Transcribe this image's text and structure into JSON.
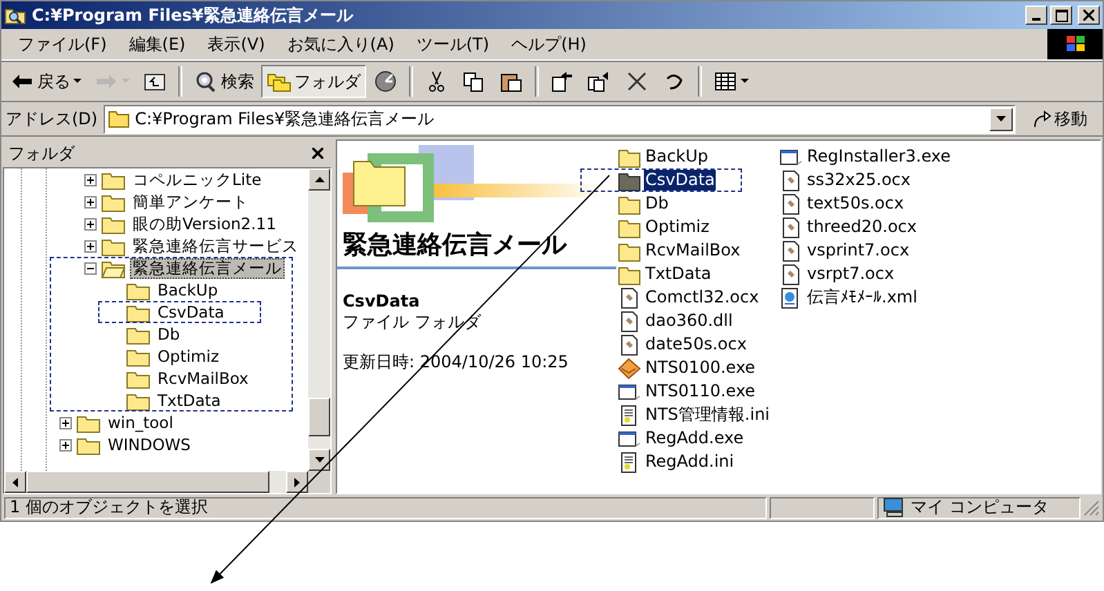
{
  "window": {
    "title": "C:¥Program Files¥緊急連絡伝言メール"
  },
  "menu": [
    "ファイル(F)",
    "編集(E)",
    "表示(V)",
    "お気に入り(A)",
    "ツール(T)",
    "ヘルプ(H)"
  ],
  "toolbar": {
    "groups": [
      [
        {
          "kind": "back",
          "label": "戻る",
          "dropdown": true,
          "disabled": false,
          "selected": false
        },
        {
          "kind": "forward",
          "dropdown": true,
          "disabled": true,
          "selected": false
        },
        {
          "kind": "up",
          "dropdown": false,
          "disabled": false,
          "selected": false
        }
      ],
      [
        {
          "kind": "search",
          "label": "検索",
          "dropdown": false,
          "disabled": false,
          "selected": false
        },
        {
          "kind": "folders",
          "label": "フォルダ",
          "dropdown": false,
          "disabled": false,
          "selected": true
        },
        {
          "kind": "history",
          "dropdown": false,
          "disabled": false,
          "selected": false
        }
      ],
      [
        {
          "kind": "cut",
          "dropdown": false,
          "disabled": false,
          "selected": false
        },
        {
          "kind": "copy",
          "dropdown": false,
          "disabled": false,
          "selected": false
        },
        {
          "kind": "paste",
          "dropdown": false,
          "disabled": false,
          "selected": false
        }
      ],
      [
        {
          "kind": "moveto",
          "dropdown": false,
          "disabled": false,
          "selected": false
        },
        {
          "kind": "copyto",
          "dropdown": false,
          "disabled": false,
          "selected": false
        },
        {
          "kind": "delete",
          "dropdown": false,
          "disabled": false,
          "selected": false
        },
        {
          "kind": "undo",
          "dropdown": false,
          "disabled": false,
          "selected": false
        }
      ],
      [
        {
          "kind": "views",
          "dropdown": true,
          "disabled": false,
          "selected": false
        }
      ]
    ]
  },
  "address": {
    "label": "アドレス(D)",
    "value": "C:¥Program Files¥緊急連絡伝言メール",
    "go": "移動"
  },
  "folder_pane": {
    "title": "フォルダ",
    "tree": [
      {
        "children": [
          {
            "label": "コペルニックLite",
            "expanded": false,
            "selected": false,
            "marked": false
          },
          {
            "label": "簡単アンケート",
            "expanded": false,
            "selected": false,
            "marked": false
          },
          {
            "label": "眼の助Version2.11",
            "expanded": false,
            "selected": false,
            "marked": false
          },
          {
            "label": "緊急連絡伝言サービス",
            "expanded": false,
            "selected": false,
            "marked": false
          },
          {
            "label": "緊急連絡伝言メール",
            "expanded": true,
            "selected": true,
            "marked": true,
            "children": [
              {
                "label": "BackUp",
                "selected": false,
                "marked": false
              },
              {
                "label": "CsvData",
                "selected": false,
                "marked": true
              },
              {
                "label": "Db",
                "selected": false,
                "marked": false
              },
              {
                "label": "Optimiz",
                "selected": false,
                "marked": false
              },
              {
                "label": "RcvMailBox",
                "selected": false,
                "marked": false
              },
              {
                "label": "TxtData",
                "selected": false,
                "marked": false
              }
            ]
          }
        ]
      },
      {
        "label": "win_tool",
        "expanded": false,
        "selected": false,
        "marked": false
      },
      {
        "label": "WINDOWS",
        "expanded": false,
        "selected": false,
        "marked": false
      }
    ]
  },
  "details": {
    "heading": "緊急連絡伝言メール",
    "name": "CsvData",
    "type": "ファイル フォルダ",
    "modified": "更新日時: 2004/10/26 10:25"
  },
  "files": [
    {
      "name": "BackUp",
      "kind": "folder",
      "selected": false,
      "marked": false
    },
    {
      "name": "CsvData",
      "kind": "folder",
      "selected": true,
      "marked": true
    },
    {
      "name": "Db",
      "kind": "folder",
      "selected": false,
      "marked": false
    },
    {
      "name": "Optimiz",
      "kind": "folder",
      "selected": false,
      "marked": false
    },
    {
      "name": "RcvMailBox",
      "kind": "folder",
      "selected": false,
      "marked": false
    },
    {
      "name": "TxtData",
      "kind": "folder",
      "selected": false,
      "marked": false
    },
    {
      "name": "Comctl32.ocx",
      "kind": "component",
      "selected": false,
      "marked": false
    },
    {
      "name": "dao360.dll",
      "kind": "component",
      "selected": false,
      "marked": false
    },
    {
      "name": "date50s.ocx",
      "kind": "component",
      "selected": false,
      "marked": false
    },
    {
      "name": "NTS0100.exe",
      "kind": "envelope",
      "selected": false,
      "marked": false
    },
    {
      "name": "NTS0110.exe",
      "kind": "program",
      "selected": false,
      "marked": false
    },
    {
      "name": "NTS管理情報.ini",
      "kind": "settings",
      "selected": false,
      "marked": false
    },
    {
      "name": "RegAdd.exe",
      "kind": "program",
      "selected": false,
      "marked": false
    },
    {
      "name": "RegAdd.ini",
      "kind": "settings",
      "selected": false,
      "marked": false
    },
    {
      "name": "RegInstaller3.exe",
      "kind": "program",
      "selected": false,
      "marked": false
    },
    {
      "name": "ss32x25.ocx",
      "kind": "component",
      "selected": false,
      "marked": false
    },
    {
      "name": "text50s.ocx",
      "kind": "component",
      "selected": false,
      "marked": false
    },
    {
      "name": "threed20.ocx",
      "kind": "component",
      "selected": false,
      "marked": false
    },
    {
      "name": "vsprint7.ocx",
      "kind": "component",
      "selected": false,
      "marked": false
    },
    {
      "name": "vsrpt7.ocx",
      "kind": "component",
      "selected": false,
      "marked": false
    },
    {
      "name": "伝言ﾒﾓﾒｰﾙ.xml",
      "kind": "xml",
      "selected": false,
      "marked": false
    }
  ],
  "status_bar": {
    "text": "1 個のオブジェクトを選択",
    "location": "マイ コンピュータ"
  }
}
